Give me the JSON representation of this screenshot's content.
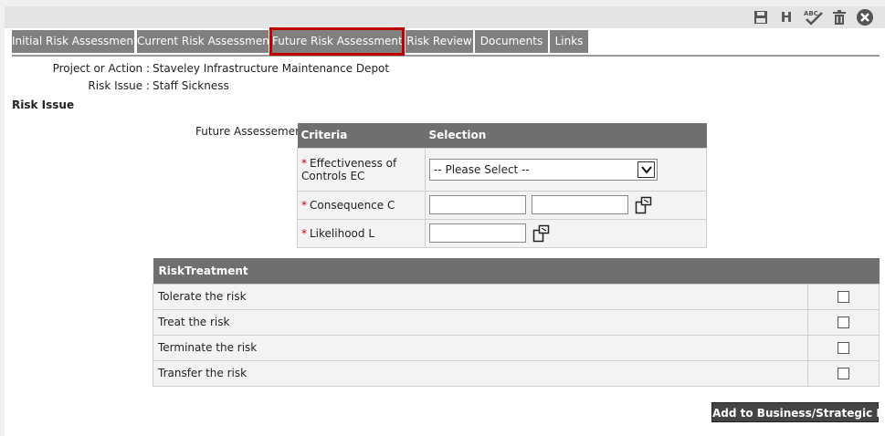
{
  "toolbar": {
    "icons": [
      "save-icon",
      "history-icon",
      "spellcheck-icon",
      "delete-icon",
      "close-icon"
    ],
    "history_letter": "H",
    "spell_letters": "ABC"
  },
  "tabs": [
    {
      "label": "Initial Risk Assessment"
    },
    {
      "label": "Current Risk Assessment"
    },
    {
      "label": "Future Risk Assessment",
      "active": true
    },
    {
      "label": "Risk Review"
    },
    {
      "label": "Documents"
    },
    {
      "label": "Links"
    }
  ],
  "header": {
    "project_label": "Project or Action :",
    "project_value": "Staveley Infrastructure Maintenance Depot",
    "issue_label": "Risk Issue :",
    "issue_value": "Staff Sickness"
  },
  "section_title": "Risk Issue",
  "assessment": {
    "label": "Future Assessement:",
    "col_criteria": "Criteria",
    "col_selection": "Selection",
    "rows": [
      {
        "label": "Effectiveness of Controls EC",
        "required": "*",
        "select_value": "-- Please Select --"
      },
      {
        "label": "Consequence C",
        "required": "*"
      },
      {
        "label": "Likelihood L",
        "required": "*"
      }
    ]
  },
  "treatment": {
    "header": "RiskTreatment",
    "rows": [
      {
        "label": "Tolerate the risk",
        "checked": false
      },
      {
        "label": "Treat the risk",
        "checked": false
      },
      {
        "label": "Terminate the risk",
        "checked": false
      },
      {
        "label": "Transfer the risk",
        "checked": false
      }
    ]
  },
  "add_button": "Add to Business/Strategic Plan",
  "colors": {
    "tab_bg": "#808080",
    "active_outline": "#c00000",
    "header_bg": "#6f6f6f",
    "required": "#d00000"
  }
}
